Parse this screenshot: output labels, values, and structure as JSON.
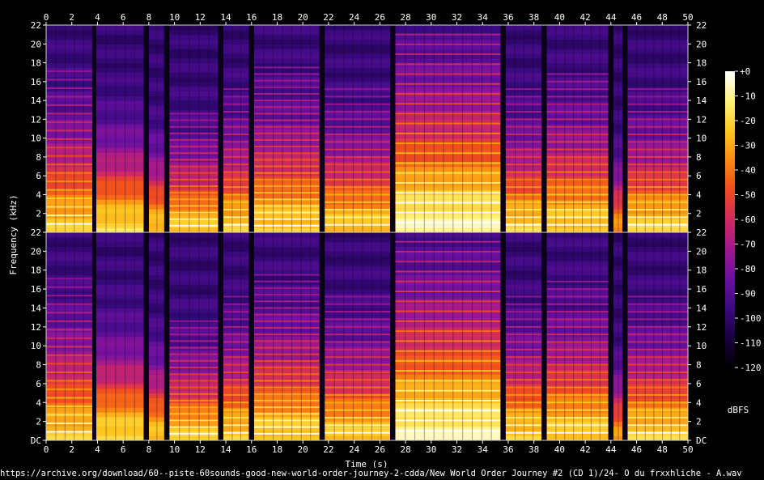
{
  "chart_data": {
    "type": "heatmap",
    "xlabel": "Time (s)",
    "ylabel": "Frequency (kHz)",
    "x_ticks": [
      0,
      2,
      4,
      6,
      8,
      10,
      12,
      14,
      16,
      18,
      20,
      22,
      24,
      26,
      28,
      30,
      32,
      34,
      36,
      38,
      40,
      42,
      44,
      46,
      48,
      50
    ],
    "xlim": [
      0,
      50
    ],
    "ylim_khz": [
      0,
      22
    ],
    "y_ticks": [
      {
        "value": 0,
        "label": "DC"
      },
      {
        "value": 2,
        "label": "2"
      },
      {
        "value": 4,
        "label": "4"
      },
      {
        "value": 6,
        "label": "6"
      },
      {
        "value": 8,
        "label": "8"
      },
      {
        "value": 10,
        "label": "10"
      },
      {
        "value": 12,
        "label": "12"
      },
      {
        "value": 14,
        "label": "14"
      },
      {
        "value": 16,
        "label": "16"
      },
      {
        "value": 18,
        "label": "18"
      },
      {
        "value": 20,
        "label": "20"
      },
      {
        "value": 22,
        "label": "22"
      }
    ],
    "channels": 2,
    "colorbar": {
      "label": "dBFS",
      "ticks": [
        "+0",
        "-10",
        "-20",
        "-30",
        "-40",
        "-50",
        "-60",
        "-70",
        "-80",
        "-90",
        "-100",
        "-110",
        "-120"
      ],
      "range_dbfs": [
        -120,
        0
      ],
      "colors": [
        "#000000",
        "#1a0040",
        "#3a0a80",
        "#6b10a0",
        "#a01890",
        "#d02a60",
        "#f04a20",
        "#fb8a10",
        "#fdc820",
        "#fff27a",
        "#ffffff"
      ]
    },
    "gaps_s": [
      [
        3.6,
        3.9
      ],
      [
        7.6,
        8.0
      ],
      [
        9.2,
        9.6
      ],
      [
        13.4,
        13.8
      ],
      [
        15.8,
        16.2
      ],
      [
        21.3,
        21.7
      ],
      [
        26.8,
        27.2
      ],
      [
        35.4,
        35.8
      ],
      [
        38.6,
        39.0
      ],
      [
        43.8,
        44.2
      ],
      [
        44.9,
        45.3
      ]
    ],
    "segments": [
      {
        "start": 0.0,
        "end": 3.6,
        "peak_khz": 8,
        "harmonic_spacing_khz": 0.9,
        "bright": 0.8
      },
      {
        "start": 3.9,
        "end": 7.6,
        "peak_khz": 7,
        "harmonic_spacing_khz": 0,
        "bright": 0.85
      },
      {
        "start": 8.0,
        "end": 9.2,
        "peak_khz": 6,
        "harmonic_spacing_khz": 0,
        "bright": 0.8
      },
      {
        "start": 9.6,
        "end": 13.4,
        "peak_khz": 6,
        "harmonic_spacing_khz": 0.7,
        "bright": 0.8
      },
      {
        "start": 13.8,
        "end": 15.8,
        "peak_khz": 7,
        "harmonic_spacing_khz": 0.8,
        "bright": 0.8
      },
      {
        "start": 16.2,
        "end": 21.3,
        "peak_khz": 8,
        "harmonic_spacing_khz": 0.7,
        "bright": 0.82
      },
      {
        "start": 21.7,
        "end": 26.8,
        "peak_khz": 7,
        "harmonic_spacing_khz": 0.8,
        "bright": 0.8
      },
      {
        "start": 27.2,
        "end": 35.4,
        "peak_khz": 11,
        "harmonic_spacing_khz": 1.05,
        "bright": 0.95
      },
      {
        "start": 35.8,
        "end": 38.6,
        "peak_khz": 7,
        "harmonic_spacing_khz": 0.8,
        "bright": 0.82
      },
      {
        "start": 39.0,
        "end": 43.8,
        "peak_khz": 8,
        "harmonic_spacing_khz": 0.8,
        "bright": 0.82
      },
      {
        "start": 44.2,
        "end": 44.9,
        "peak_khz": 5,
        "harmonic_spacing_khz": 0,
        "bright": 0.7
      },
      {
        "start": 45.3,
        "end": 50.0,
        "peak_khz": 7,
        "harmonic_spacing_khz": 0.8,
        "bright": 0.82
      }
    ]
  },
  "footer": {
    "source_text": "https://archive.org/download/60--piste-60sounds-good-new-world-order-journey-2-cdda/New World Order Journey #2 (CD 1)/24- O du frxxhliche - A.wav"
  }
}
